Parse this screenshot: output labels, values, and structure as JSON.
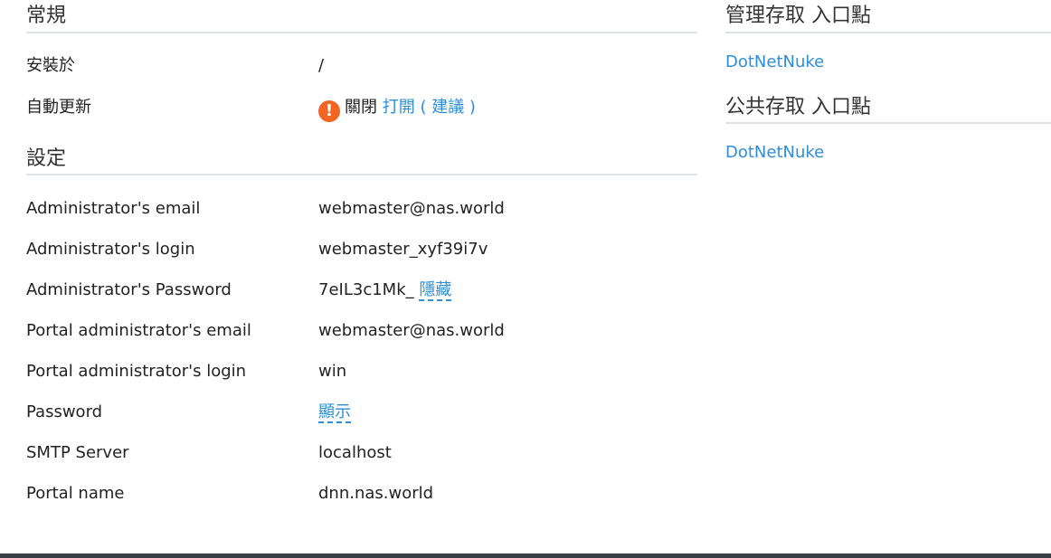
{
  "general": {
    "heading": "常規",
    "install_label": "安裝於",
    "install_value": "/",
    "autoupdate_label": "自動更新",
    "autoupdate_status": "關閉",
    "autoupdate_turn_on": "打開",
    "autoupdate_hint": "( 建議 )"
  },
  "settings": {
    "heading": "設定",
    "rows": [
      {
        "label": "Administrator's email",
        "value": "webmaster@nas.world"
      },
      {
        "label": "Administrator's login",
        "value": "webmaster_xyf39i7v"
      },
      {
        "label": "Administrator's Password",
        "value": "7eIL3c1Mk_",
        "action": "隱藏"
      },
      {
        "label": "Portal administrator's email",
        "value": "webmaster@nas.world"
      },
      {
        "label": "Portal administrator's login",
        "value": "win"
      },
      {
        "label": "Password",
        "value": "",
        "action": "顯示"
      },
      {
        "label": "SMTP Server",
        "value": "localhost"
      },
      {
        "label": "Portal name",
        "value": "dnn.nas.world"
      }
    ]
  },
  "admin_access": {
    "heading": "管理存取 入口點",
    "link": "DotNetNuke"
  },
  "public_access": {
    "heading": "公共存取 入口點",
    "link": "DotNetNuke"
  },
  "colors": {
    "link": "#2e8fd6",
    "warning": "#f26522",
    "rule": "#dfe2e5"
  },
  "icons": {
    "autoupdate_warning": "exclamation-circle-icon"
  }
}
